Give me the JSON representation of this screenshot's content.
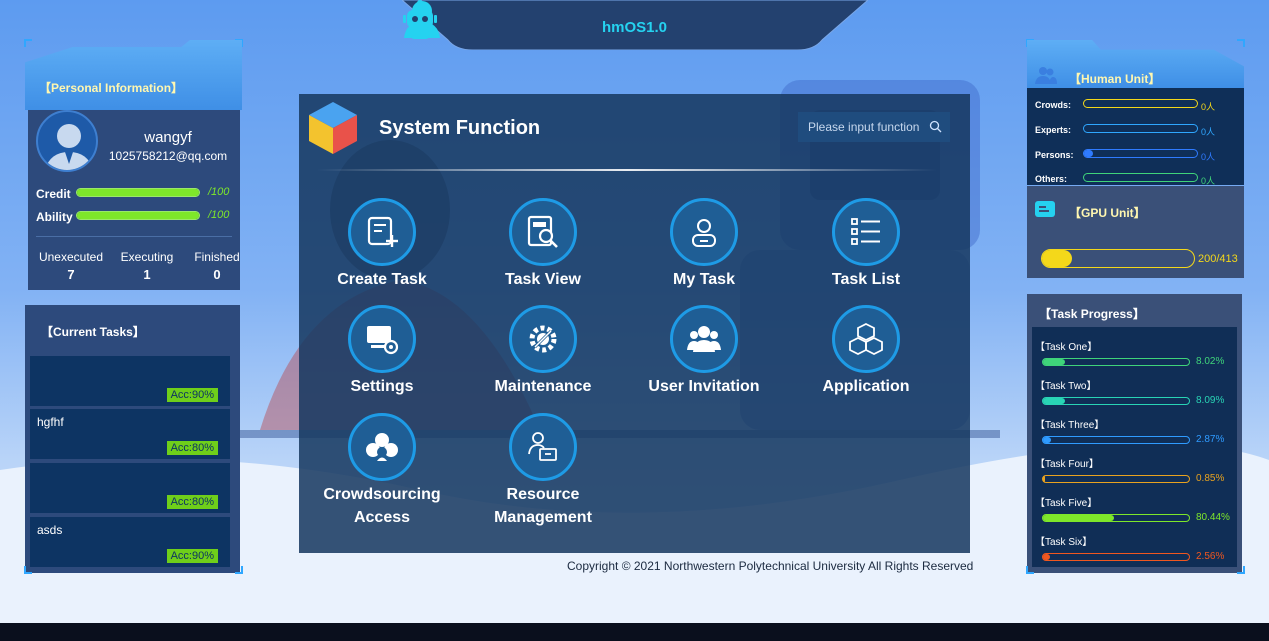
{
  "header": {
    "brand": "hmOS1.0"
  },
  "profile": {
    "section_title": "【Personal Information】",
    "name": "wangyf",
    "email": "1025758212@qq.com",
    "credit_label": "Credit",
    "credit_max": "/100",
    "credit_value": 100,
    "ability_label": "Ability",
    "ability_max": "/100",
    "ability_value": 100,
    "counts": [
      {
        "label": "Unexecuted",
        "value": "7"
      },
      {
        "label": "Executing",
        "value": "1"
      },
      {
        "label": "Finished",
        "value": "0"
      }
    ]
  },
  "current_tasks": {
    "title": "【Current Tasks】",
    "items": [
      {
        "name": "",
        "acc": "Acc:90%"
      },
      {
        "name": "hgfhf",
        "acc": "Acc:80%"
      },
      {
        "name": "",
        "acc": "Acc:80%"
      },
      {
        "name": "asds",
        "acc": "Acc:90%"
      }
    ]
  },
  "main": {
    "title": "System Function",
    "search_placeholder": "Please input function",
    "functions": [
      {
        "label": "Create Task",
        "icon": "create-task-icon"
      },
      {
        "label": "Task View",
        "icon": "task-view-icon"
      },
      {
        "label": "My Task",
        "icon": "my-task-icon"
      },
      {
        "label": "Task List",
        "icon": "task-list-icon"
      },
      {
        "label": "Settings",
        "icon": "settings-icon"
      },
      {
        "label": "Maintenance",
        "icon": "maintenance-icon"
      },
      {
        "label": "User Invitation",
        "icon": "user-invitation-icon"
      },
      {
        "label": "Application",
        "icon": "application-icon"
      },
      {
        "label": "Crowdsourcing Access",
        "icon": "crowdsourcing-icon"
      },
      {
        "label": "Resource Management",
        "icon": "resource-management-icon"
      }
    ]
  },
  "copyright": "Copyright © 2021 Northwestern Polytechnical University All Rights Reserved",
  "human_unit": {
    "title": "【Human Unit】",
    "rows": [
      {
        "label": "Crowds:",
        "value": "0人",
        "fill": 0.0,
        "color": "#f4d81a"
      },
      {
        "label": "Experts:",
        "value": "0人",
        "fill": 0.0,
        "color": "#2fa7ff"
      },
      {
        "label": "Persons:",
        "value": "0人",
        "fill": 0.08,
        "color": "#2f7bff"
      },
      {
        "label": "Others:",
        "value": "0人",
        "fill": 0.0,
        "color": "#3fd47a"
      }
    ]
  },
  "gpu_unit": {
    "title": "【GPU Unit】",
    "value": "200/413",
    "fill": 0.2
  },
  "task_progress": {
    "title": "【Task Progress】",
    "tasks": [
      {
        "name": "【Task One】",
        "value": "8.02%",
        "fill": 0.1504,
        "color": "#3fd47a"
      },
      {
        "name": "【Task Two】",
        "value": "8.09%",
        "fill": 0.1518,
        "color": "#29d4b5"
      },
      {
        "name": "【Task Three】",
        "value": "2.87%",
        "fill": 0.0574,
        "color": "#2f9bff"
      },
      {
        "name": "【Task Four】",
        "value": "0.85%",
        "fill": 0.017,
        "color": "#e8a21f"
      },
      {
        "name": "【Task Five】",
        "value": "80.44%",
        "fill": 0.4844,
        "color": "#7ee72a"
      },
      {
        "name": "【Task Six】",
        "value": "2.56%",
        "fill": 0.0512,
        "color": "#f0571f"
      }
    ]
  }
}
